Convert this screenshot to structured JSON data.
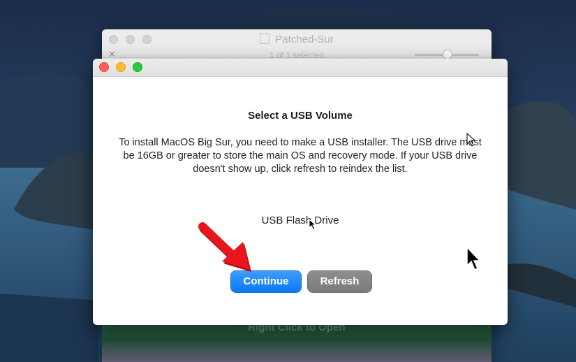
{
  "background_window": {
    "title": "Patched-Sur",
    "subtitle": "1 of 1 selected",
    "content_label": "Right Click to Open"
  },
  "dialog": {
    "heading": "Select a USB Volume",
    "description": "To install MacOS Big Sur, you need to make a USB installer. The USB drive must be 16GB or greater to store the main OS and recovery mode. If your USB drive doesn't show up, click refresh to reindex the list.",
    "volumes": [
      "USB Flash Drive"
    ],
    "continue_label": "Continue",
    "refresh_label": "Refresh"
  },
  "colors": {
    "accent": "#0a78f5",
    "annotation_arrow": "#e8151b"
  },
  "icons": [
    "drive-icon",
    "close-light",
    "minimize-light",
    "maximize-light",
    "arrow-annotation",
    "mouse-pointer"
  ]
}
